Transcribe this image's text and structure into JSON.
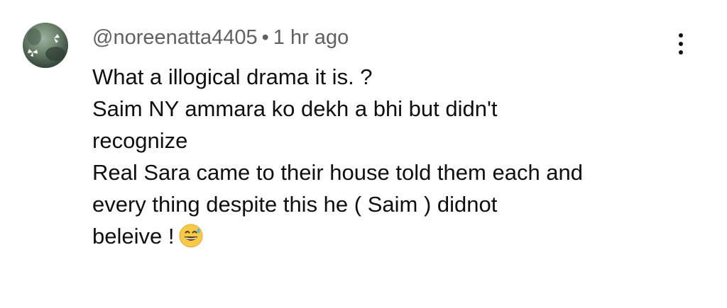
{
  "comment": {
    "author": "@noreenatta4405",
    "separator": "•",
    "timestamp": "1 hr ago",
    "avatar_icon": "butterfly-avatar-icon",
    "menu_icon": "more-vertical-icon",
    "lines": [
      "What a illogical drama it is. ?",
      "Saim NY ammara ko dekh a bhi but didn't",
      "recognize",
      "Real Sara came to their house told them each and",
      "every thing despite this he ( Saim ) didnot",
      "beleive !"
    ],
    "emoji_icon": "grinning-face-with-sweat-emoji-icon"
  }
}
